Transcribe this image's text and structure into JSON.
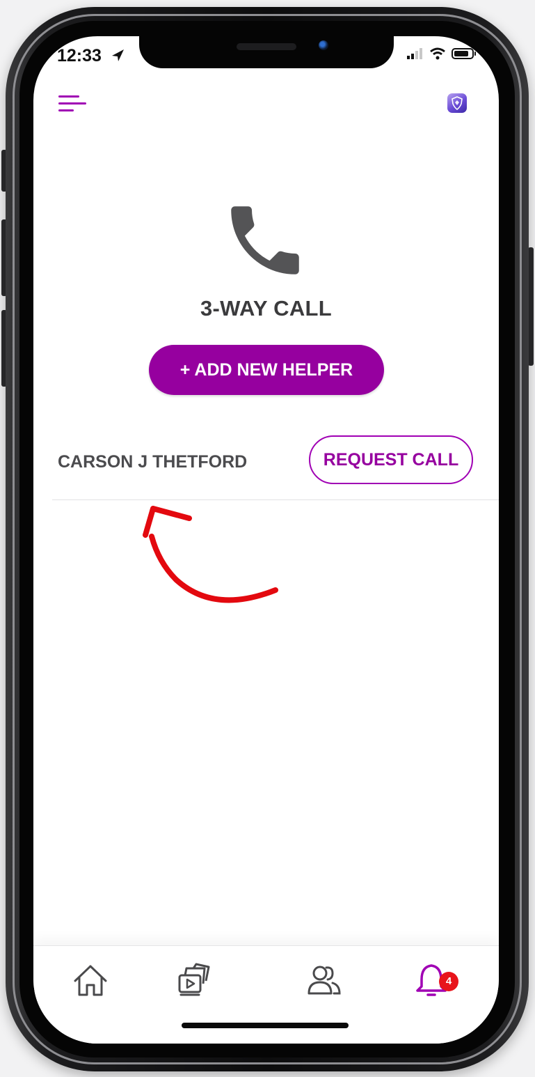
{
  "status_bar": {
    "time": "12:33"
  },
  "header": {
    "menu_icon": "hamburger-menu-icon",
    "shield_icon": "shield-app-icon"
  },
  "main": {
    "icon": "phone-handset-icon",
    "title": "3-WAY CALL",
    "add_button_label": "+ ADD NEW HELPER",
    "helpers": [
      {
        "name": "CARSON J THETFORD",
        "action_label": "REQUEST CALL"
      }
    ]
  },
  "tab_bar": {
    "items": [
      {
        "name": "home",
        "icon": "home-icon"
      },
      {
        "name": "media",
        "icon": "media-gallery-icon"
      },
      {
        "name": "people",
        "icon": "people-icon"
      },
      {
        "name": "notifications",
        "icon": "bell-icon",
        "badge": "4"
      }
    ]
  },
  "colors": {
    "brand": "#96009f",
    "annotation_arrow": "#e3090f",
    "badge": "#e8141b",
    "title_text": "#3b3b3d"
  }
}
